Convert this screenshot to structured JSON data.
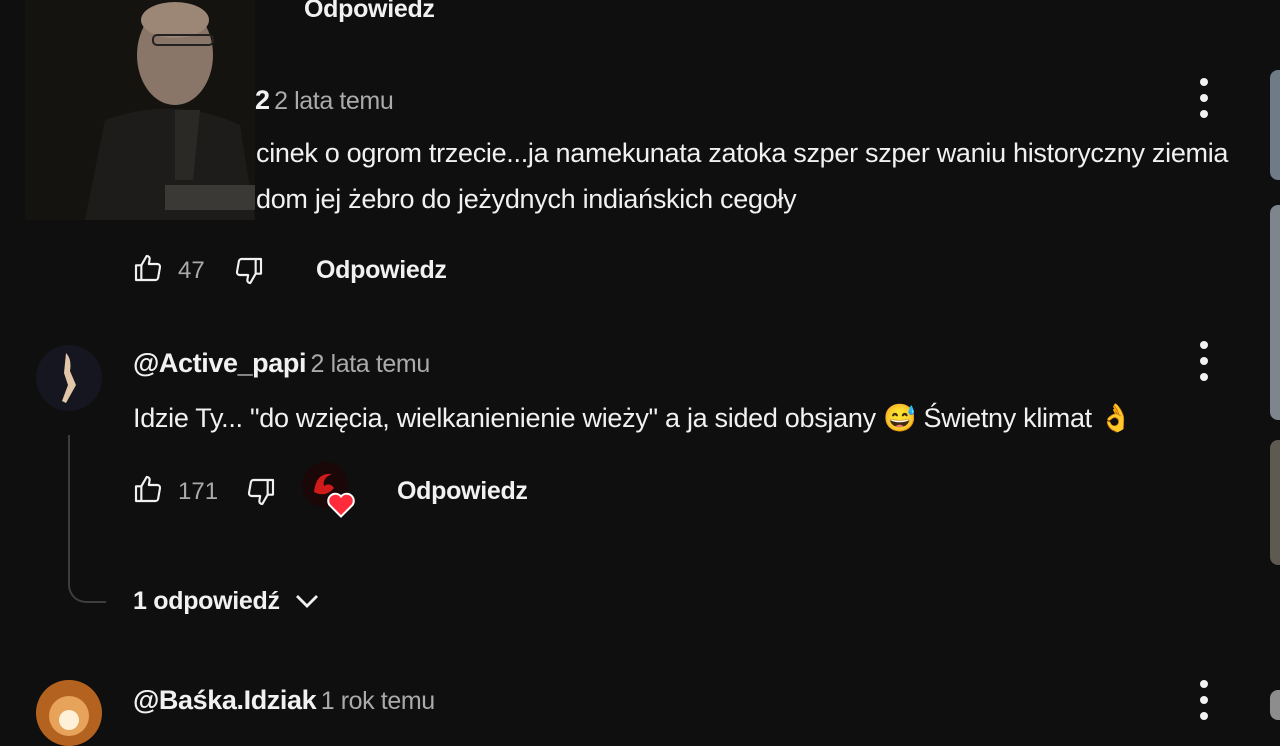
{
  "top_reply": {
    "label": "Odpowiedz"
  },
  "comment1": {
    "author_partial": "2",
    "time": "2 lata temu",
    "line1": "cinek o ogrom trzecie...ja namekunata zatoka szper szper waniu historyczny ziemia",
    "line2": "dom jej żebro do jeżydnych indiańskich cegoły",
    "likes": "47",
    "reply_label": "Odpowiedz"
  },
  "comment2": {
    "author": "@Active_papi",
    "time": "2 lata temu",
    "text": "Idzie Ty... \"do wzięcia, wielkanienienie wieży\" a ja sided obsjany",
    "emoji1": "😅",
    "text2": "Świetny klimat",
    "emoji2": "👌",
    "likes": "171",
    "reply_label": "Odpowiedz",
    "replies_toggle": "1 odpowiedź"
  },
  "comment3": {
    "author": "@Baśka.Idziak",
    "time": "1 rok temu"
  },
  "colors": {
    "background": "#0f0f0f",
    "text": "#f1f1f1",
    "secondary_text": "#aaaaaa",
    "heart": "#ff2a3a"
  }
}
